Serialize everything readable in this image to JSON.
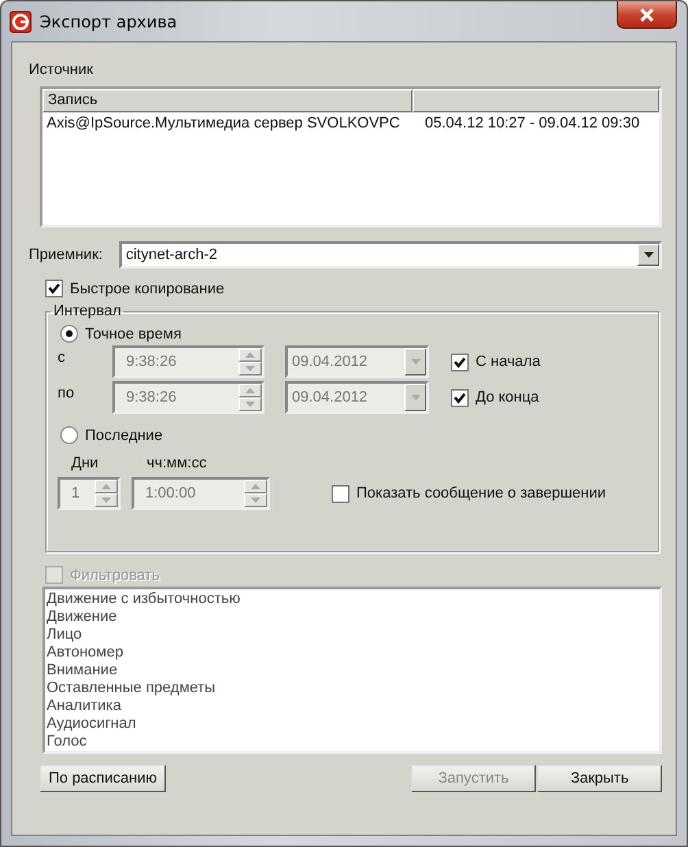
{
  "window": {
    "title": "Экспорт архива"
  },
  "source": {
    "label": "Источник",
    "columns": [
      "Запись"
    ],
    "rows": [
      {
        "cells": [
          "Axis@IpSource.Мультимедиа сервер SVOLKOVPC",
          "05.04.12 10:27 - 09.04.12 09:30"
        ],
        "selected": false
      }
    ]
  },
  "receiver": {
    "label": "Приемник:",
    "value": "citynet-arch-2"
  },
  "fast_copy": {
    "label": "Быстрое копирование",
    "checked": true
  },
  "interval": {
    "title": "Интервал",
    "modes": [
      {
        "label": "Точное время",
        "selected": true
      },
      {
        "label": "Последние",
        "selected": false
      }
    ],
    "exact": [
      {
        "label": "с",
        "time": "9:38:26",
        "date": "09.04.2012",
        "disabled": true,
        "check": {
          "label": "С начала",
          "checked": true
        }
      },
      {
        "label": "по",
        "time": "9:38:26",
        "date": "09.04.2012",
        "disabled": true,
        "check": {
          "label": "До конца",
          "checked": true
        }
      }
    ],
    "last": {
      "days_label": "Дни",
      "days": "1",
      "time_label": "чч:мм:сс",
      "time": "1:00:00",
      "disabled": true
    },
    "notify": {
      "label": "Показать сообщение о завершении",
      "checked": false
    }
  },
  "filter": {
    "label": "Фильтровать",
    "checked": false,
    "disabled": true
  },
  "filter_items": [
    "Движение с избыточностью",
    "Движение",
    "Лицо",
    "Автономер",
    "Внимание",
    "Оставленные предметы",
    "Аналитика",
    "Аудиосигнал",
    "Голос"
  ],
  "buttons": [
    {
      "label": "По расписанию",
      "disabled": false,
      "kind": "left"
    },
    {
      "label": "Запустить",
      "disabled": true,
      "kind": "right"
    },
    {
      "label": "Закрыть",
      "disabled": false,
      "kind": "right"
    }
  ]
}
